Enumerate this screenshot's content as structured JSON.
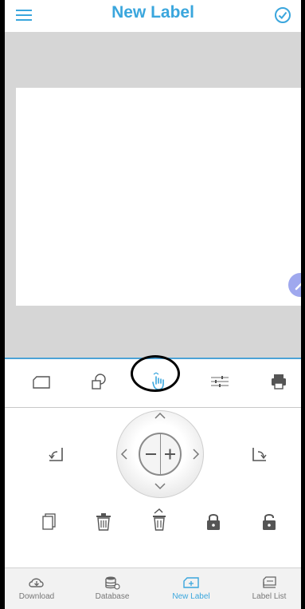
{
  "header": {
    "title": "New Label",
    "menu_icon": "hamburger-menu-icon",
    "done_icon": "check-circle-icon"
  },
  "canvas": {
    "fab_icon": "edit-pen-icon"
  },
  "tool_tabs": [
    {
      "name": "label-settings",
      "icon": "label-shape-icon"
    },
    {
      "name": "add-object",
      "icon": "shapes-icon"
    },
    {
      "name": "move-object",
      "icon": "hand-touch-icon",
      "active": true
    },
    {
      "name": "properties",
      "icon": "sliders-icon"
    },
    {
      "name": "print",
      "icon": "printer-icon"
    }
  ],
  "controls": {
    "rotate_left_icon": "rotate-left-icon",
    "rotate_right_icon": "rotate-right-icon",
    "zoom_out_symbol": "−",
    "zoom_in_symbol": "+",
    "copy_icon": "copy-icon",
    "delete_icon": "trash-icon",
    "delete_all_icon": "trash-restore-icon",
    "lock_icon": "lock-icon",
    "unlock_icon": "unlock-icon"
  },
  "bottom_nav": [
    {
      "label": "Download",
      "icon": "cloud-download-icon"
    },
    {
      "label": "Database",
      "icon": "database-icon"
    },
    {
      "label": "New Label",
      "icon": "new-label-icon",
      "active": true
    },
    {
      "label": "Label List",
      "icon": "label-list-icon"
    }
  ],
  "colors": {
    "accent": "#3aa6dd",
    "icon_gray": "#8a8a8a",
    "canvas_bg": "#d6d6d6",
    "fab": "#9fa8ee"
  }
}
